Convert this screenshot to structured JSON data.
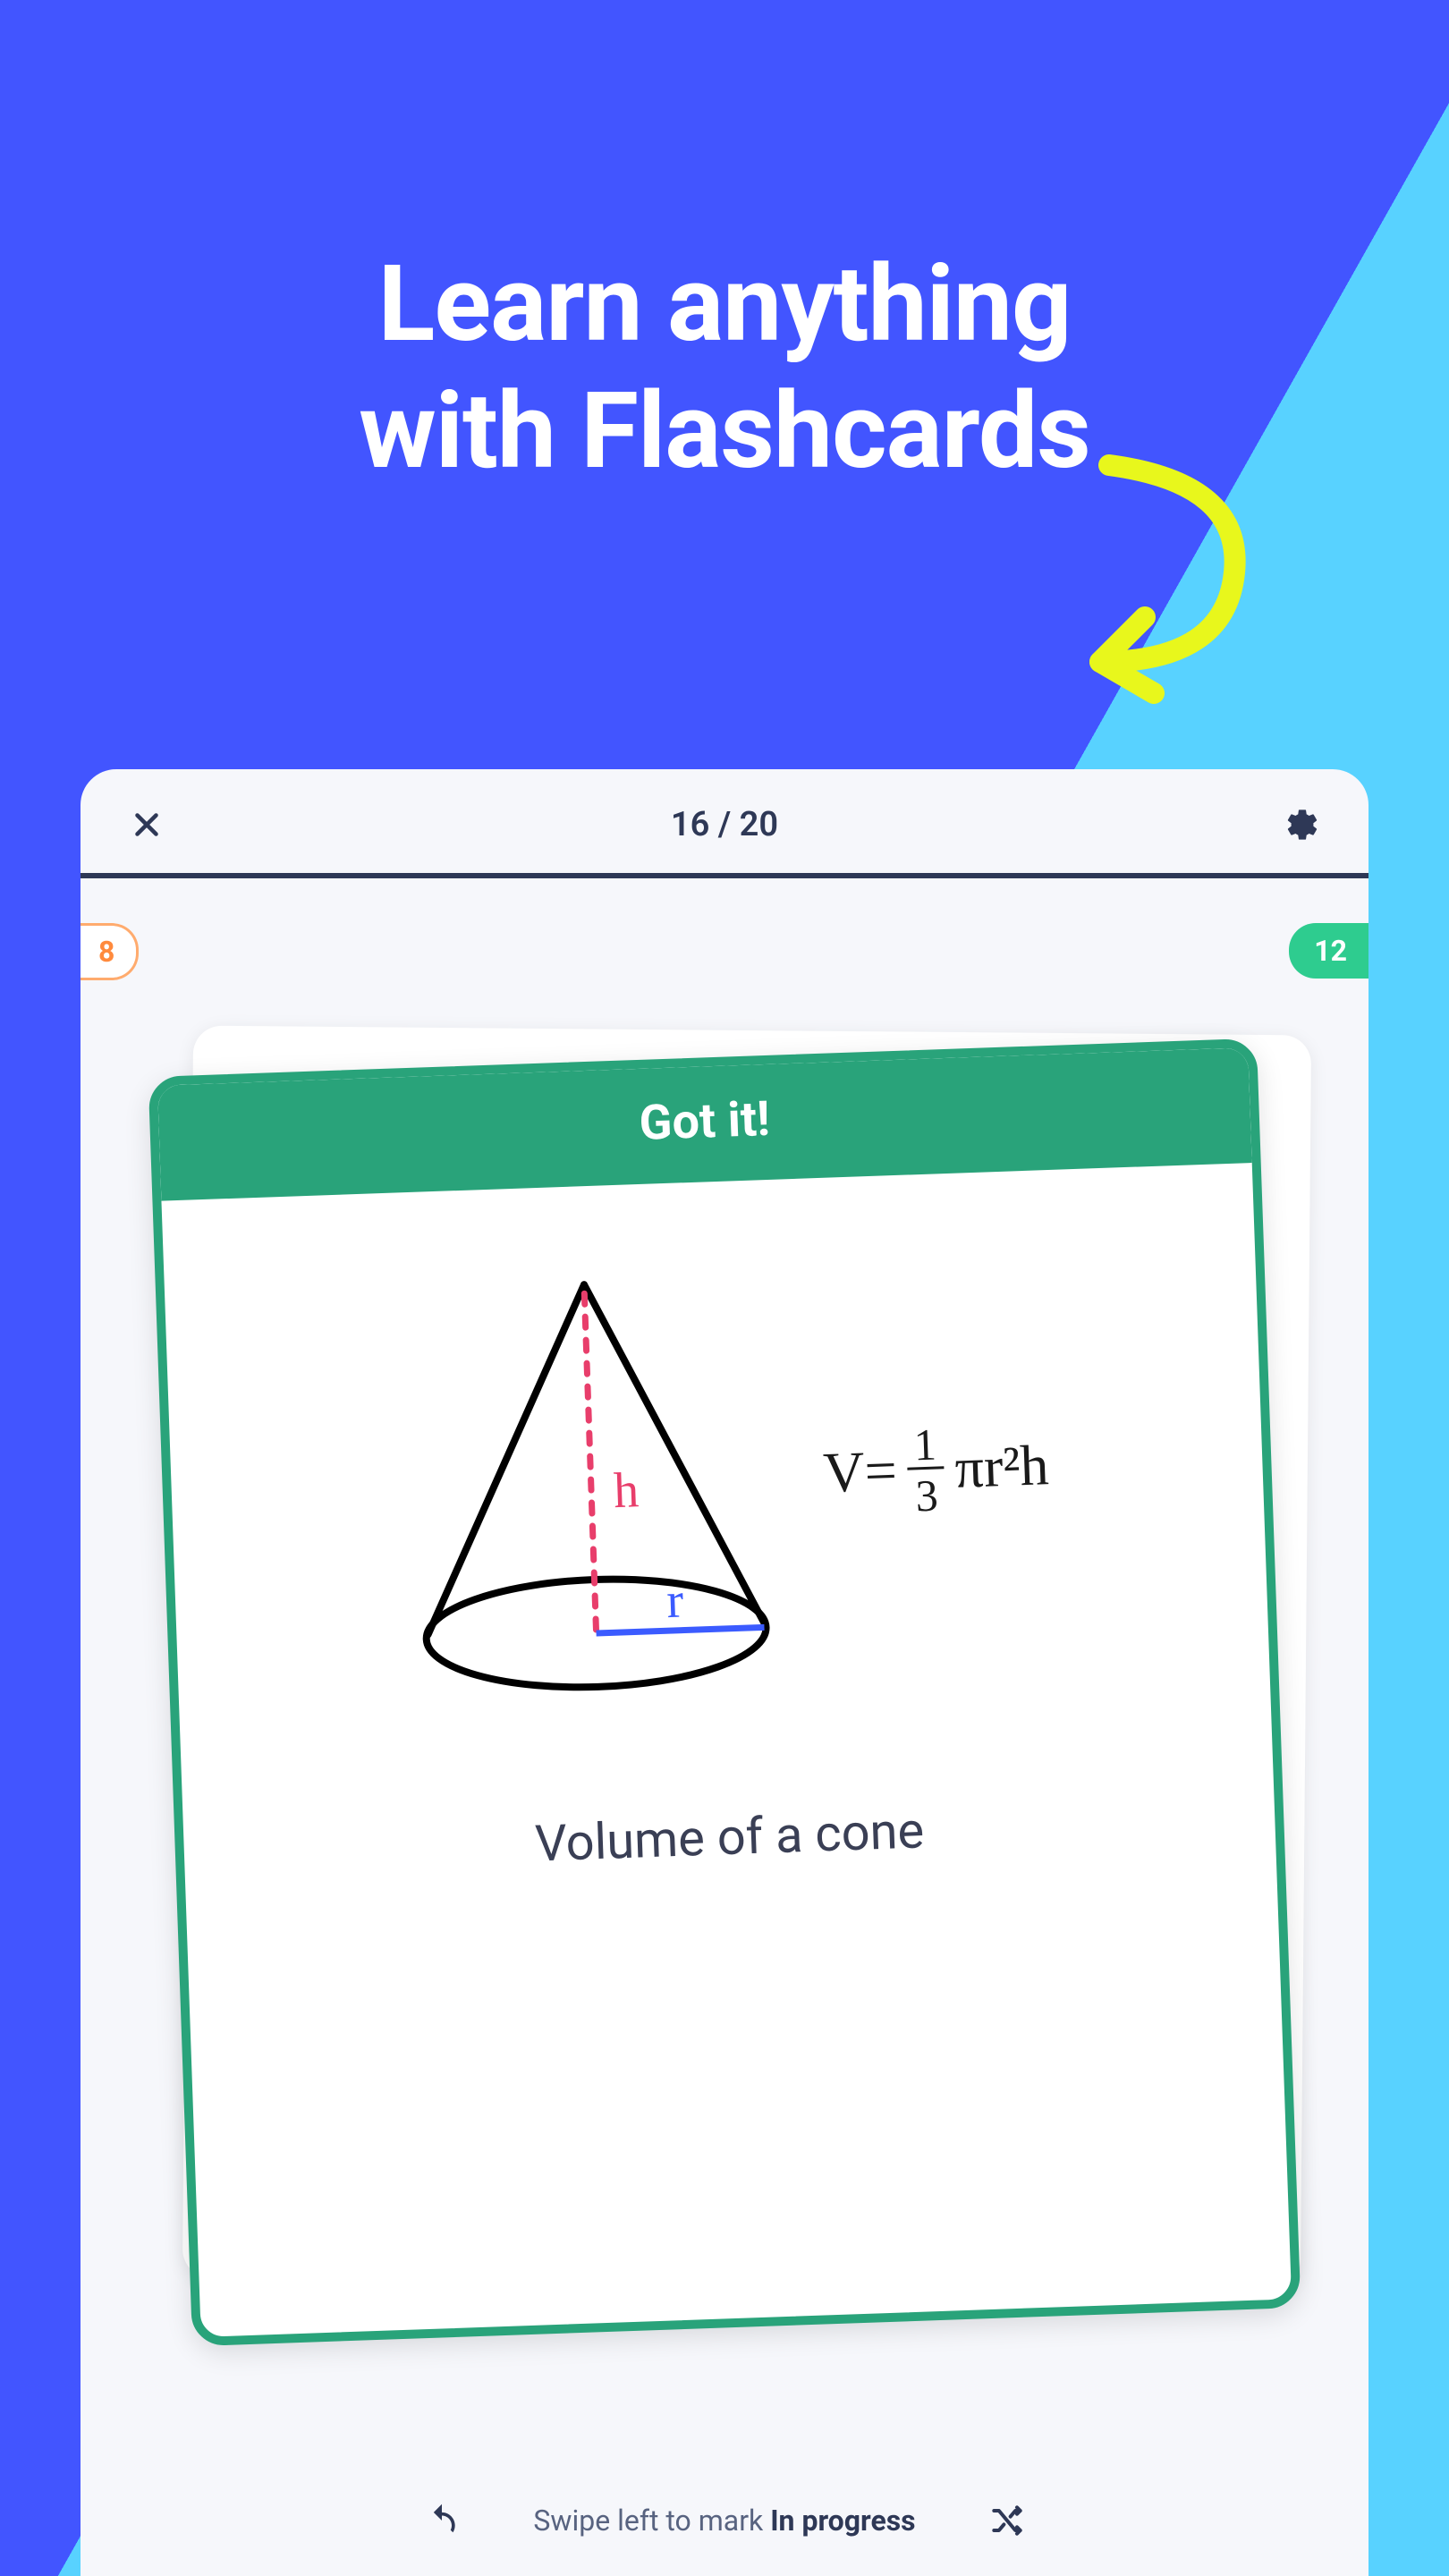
{
  "hero": {
    "line1": "Learn anything",
    "line2": "with Flashcards"
  },
  "panel": {
    "progress": "16 / 20",
    "badge_left": "8",
    "badge_right": "12"
  },
  "card": {
    "header": "Got it!",
    "label_h": "h",
    "label_r": "r",
    "formula_v": "V=",
    "formula_num": "1",
    "formula_den": "3",
    "formula_rest": "πr²h",
    "caption": "Volume of a cone"
  },
  "footer": {
    "swipe_prefix": "Swipe left to mark ",
    "swipe_bold": "In progress"
  }
}
